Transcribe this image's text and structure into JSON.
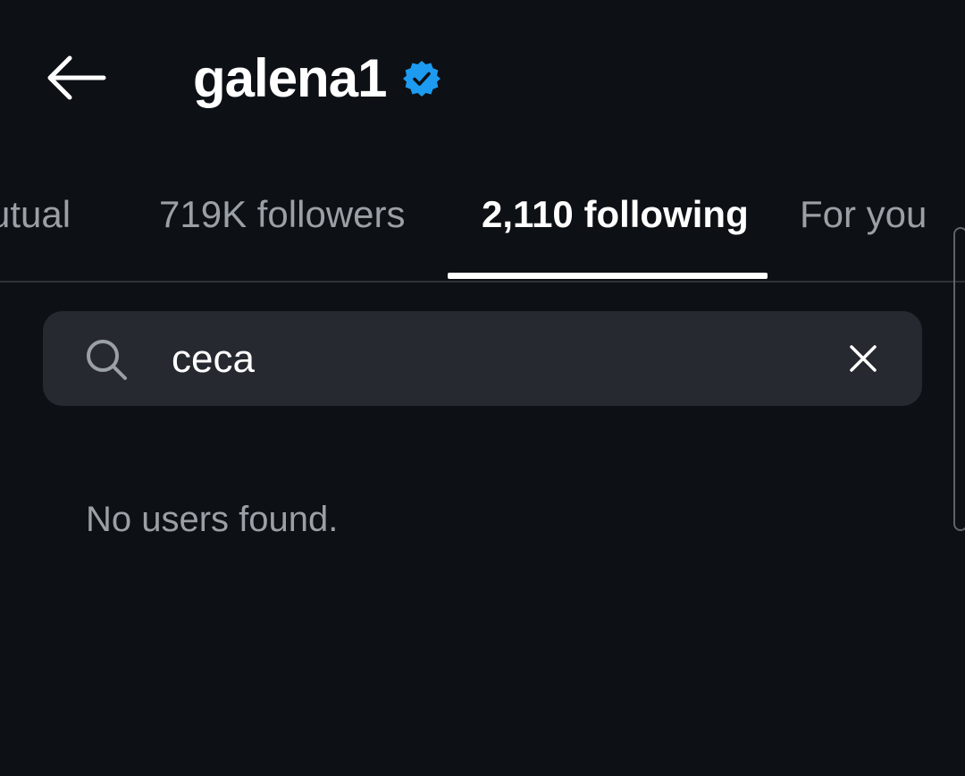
{
  "header": {
    "back_icon": "arrow-left-icon",
    "title": "galena1",
    "verified_icon": "verified-badge-icon",
    "verified_color": "#1d9bf0"
  },
  "tabs": [
    {
      "label": "utual",
      "active": false
    },
    {
      "label": "719K followers",
      "active": false
    },
    {
      "label": "2,110 following",
      "active": true
    },
    {
      "label": "For you",
      "active": false
    }
  ],
  "search": {
    "icon": "search-icon",
    "value": "ceca",
    "clear_icon": "close-icon"
  },
  "results": {
    "empty_message": "No users found."
  },
  "colors": {
    "background": "#0d1014",
    "search_background": "#262a30",
    "text_primary": "#ffffff",
    "text_secondary": "#9aa0a6",
    "divider": "#2f3337"
  }
}
